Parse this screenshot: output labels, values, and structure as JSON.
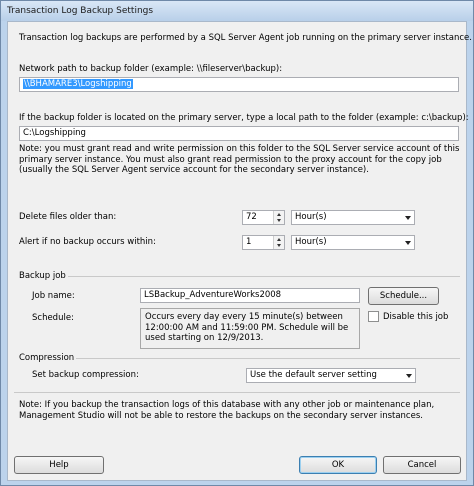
{
  "window": {
    "title": "Transaction Log Backup Settings"
  },
  "intro_text": "Transaction log backups are performed by a SQL Server Agent job running on the primary server instance.",
  "network_path": {
    "label": "Network path to backup folder (example: \\\\fileserver\\backup):",
    "value": "\\\\BHAMARE3\\Logshipping"
  },
  "local_path": {
    "label": "If the backup folder is located on the primary server, type a local path to the folder (example: c:\\backup):",
    "value": "C:\\Logshipping"
  },
  "permission_note": "Note: you must grant read and write permission on this folder to the SQL Server service account of this primary server instance. You must also grant read permission to the proxy account for the copy job (usually the SQL Server Agent service account for the secondary server instance).",
  "delete_files": {
    "label": "Delete files older than:",
    "value": "72",
    "unit": "Hour(s)"
  },
  "alert": {
    "label": "Alert if no backup occurs within:",
    "value": "1",
    "unit": "Hour(s)"
  },
  "backup_job": {
    "section_label": "Backup job",
    "job_name_label": "Job name:",
    "job_name_value": "LSBackup_AdventureWorks2008",
    "schedule_button": "Schedule...",
    "schedule_label": "Schedule:",
    "schedule_text": "Occurs every day every 15 minute(s) between 12:00:00 AM and 11:59:00 PM. Schedule will be used starting on 12/9/2013.",
    "disable_label": "Disable this job"
  },
  "compression": {
    "section_label": "Compression",
    "set_label": "Set backup compression:",
    "value": "Use the default server setting"
  },
  "footer_note": "Note: If you backup the transaction logs of this database with any other job or maintenance plan, Management Studio will not be able to restore the backups on the secondary server instances.",
  "buttons": {
    "help": "Help",
    "ok": "OK",
    "cancel": "Cancel"
  }
}
